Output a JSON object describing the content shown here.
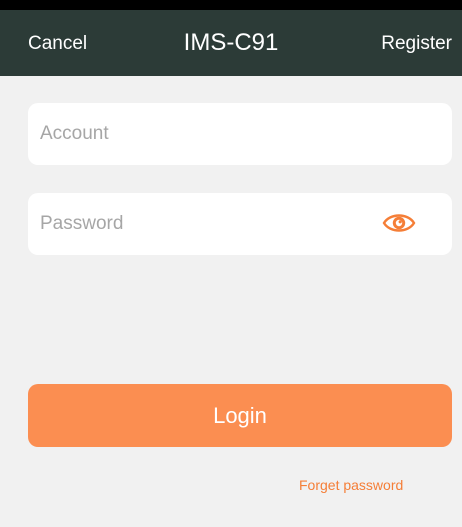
{
  "header": {
    "cancel_label": "Cancel",
    "title": "IMS-C91",
    "register_label": "Register"
  },
  "form": {
    "account_placeholder": "Account",
    "account_value": "",
    "password_placeholder": "Password",
    "password_value": "",
    "password_toggle_icon": "eye-icon"
  },
  "actions": {
    "login_label": "Login",
    "forget_label": "Forget password"
  },
  "colors": {
    "header_bg": "#2c3b37",
    "accent": "#fb8e51",
    "link": "#f57e37",
    "caret": "#45b3b0",
    "page_bg": "#f1f1f1"
  }
}
